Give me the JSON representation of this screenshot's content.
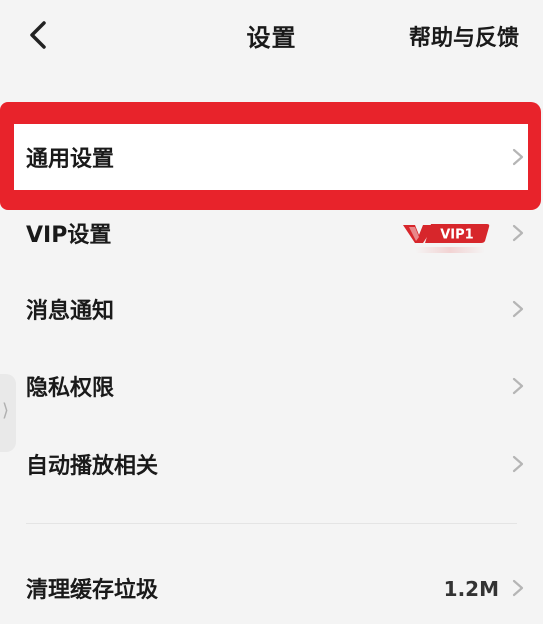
{
  "header": {
    "title": "设置",
    "help_label": "帮助与反馈"
  },
  "settings": {
    "items": [
      {
        "label": "通用设置"
      },
      {
        "label": "VIP设置",
        "badge_text": "VIP1"
      },
      {
        "label": "消息通知"
      },
      {
        "label": "隐私权限"
      },
      {
        "label": "自动播放相关"
      }
    ],
    "cache": {
      "label": "清理缓存垃圾",
      "size": "1.2M"
    }
  },
  "colors": {
    "highlight": "#e8232b",
    "vip_badge": "#d7262b",
    "background": "#f4f4f4"
  },
  "icons": [
    "back-arrow-icon",
    "chevron-right-icon",
    "vip-badge-icon",
    "side-handle-icon"
  ]
}
